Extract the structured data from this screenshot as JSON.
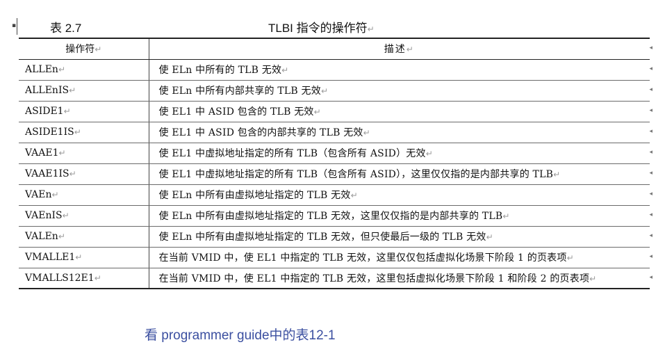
{
  "caption": {
    "number": "表 2.7",
    "title": "TLBI 指令的操作符"
  },
  "headers": [
    "操作符",
    "描述"
  ],
  "rows": [
    [
      "ALLEn",
      "使 ELn 中所有的 TLB 无效"
    ],
    [
      "ALLEnIS",
      "使 ELn 中所有内部共享的 TLB 无效"
    ],
    [
      "ASIDE1",
      "使 EL1 中 ASID 包含的 TLB 无效"
    ],
    [
      "ASIDE1IS",
      "使 EL1 中 ASID 包含的内部共享的 TLB 无效"
    ],
    [
      "VAAE1",
      "使 EL1 中虚拟地址指定的所有 TLB（包含所有 ASID）无效"
    ],
    [
      "VAAE1IS",
      "使 EL1 中虚拟地址指定的所有 TLB（包含所有 ASID），这里仅仅指的是内部共享的 TLB"
    ],
    [
      "VAEn",
      "使 ELn 中所有由虚拟地址指定的 TLB 无效"
    ],
    [
      "VAEnIS",
      "使 ELn 中所有由虚拟地址指定的 TLB 无效，这里仅仅指的是内部共享的 TLB"
    ],
    [
      "VALEn",
      "使 ELn 中所有由虚拟地址指定的 TLB 无效，但只使最后一级的 TLB 无效"
    ],
    [
      "VMALLE1",
      "在当前 VMID 中，使 EL1 中指定的 TLB 无效，这里仅仅包括虚拟化场景下阶段 1 的页表项"
    ],
    [
      "VMALLS12E1",
      "在当前 VMID 中，使 EL1 中指定的 TLB 无效，这里包括虚拟化场景下阶段 1 和阶段 2 的页表项"
    ]
  ],
  "footnote": "看 programmer guide中的表12-1",
  "colors": {
    "footnote": "#3b4fa0",
    "rule": "#222222"
  }
}
